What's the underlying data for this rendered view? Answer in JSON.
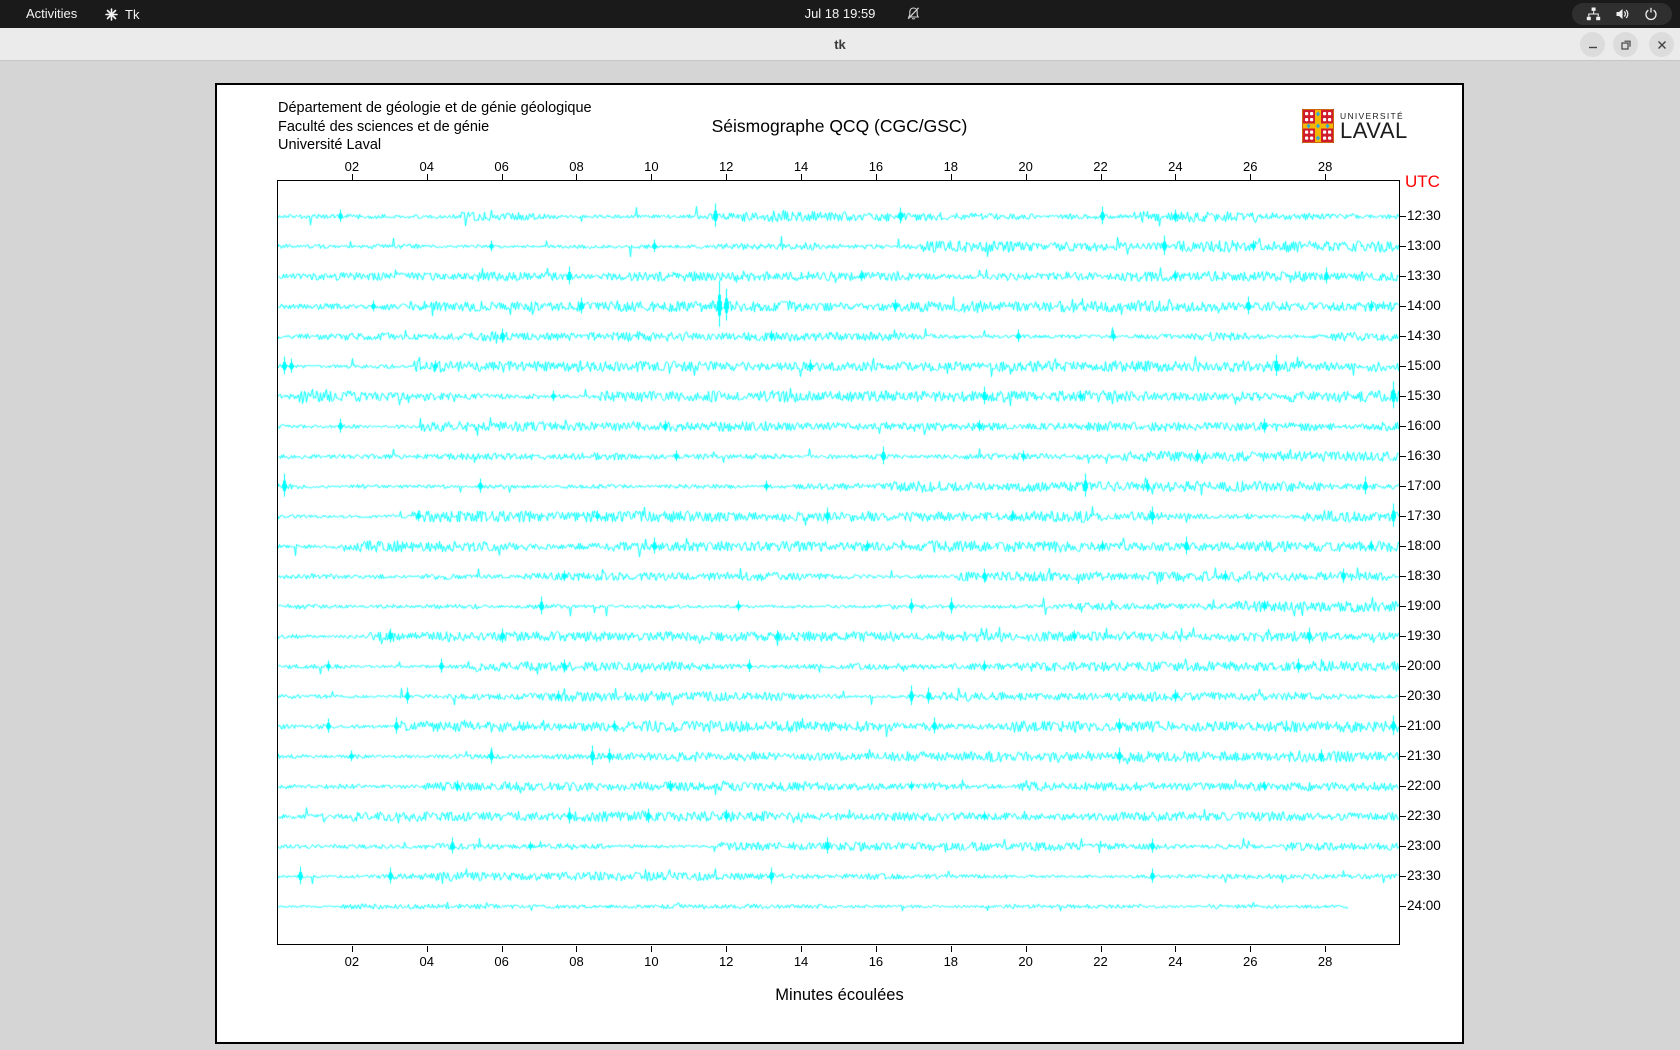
{
  "os_bar": {
    "activities_label": "Activities",
    "app_name": "Tk",
    "clock": "Jul 18 19:59",
    "icons": [
      "tk-logo",
      "notifications-off",
      "network",
      "volume",
      "power"
    ]
  },
  "window": {
    "title": "tk",
    "controls": {
      "minimize": "minimize",
      "maximize": "maximize",
      "close": "close"
    }
  },
  "seismograph": {
    "institution_lines": [
      "Département de géologie et de génie géologique",
      "Faculté des sciences et de génie",
      "Université Laval"
    ],
    "title": "Séismographe QCQ (CGC/GSC)",
    "logo": {
      "line1": "UNIVERSITÉ",
      "line2": "LAVAL",
      "crest_colors": {
        "red": "#d11c2e",
        "gold": "#f3b700",
        "blue": "#2aa9e0",
        "white": "#ffffff"
      }
    },
    "utc_label": "UTC",
    "xaxis_title": "Minutes écoulées",
    "x_range_minutes": [
      0,
      30
    ],
    "x_ticks": [
      {
        "label": "02",
        "minute": 2
      },
      {
        "label": "04",
        "minute": 4
      },
      {
        "label": "06",
        "minute": 6
      },
      {
        "label": "08",
        "minute": 8
      },
      {
        "label": "10",
        "minute": 10
      },
      {
        "label": "12",
        "minute": 12
      },
      {
        "label": "14",
        "minute": 14
      },
      {
        "label": "16",
        "minute": 16
      },
      {
        "label": "18",
        "minute": 18
      },
      {
        "label": "20",
        "minute": 20
      },
      {
        "label": "22",
        "minute": 22
      },
      {
        "label": "24",
        "minute": 24
      },
      {
        "label": "26",
        "minute": 26
      },
      {
        "label": "28",
        "minute": 28
      }
    ],
    "trace_color": "#00ffff",
    "utc_color": "#fe0000",
    "rows": [
      {
        "time": "12:30",
        "amp": 2.5,
        "end": 1.0,
        "spikes": [
          [
            0.055,
            7
          ],
          [
            0.39,
            13
          ],
          [
            0.555,
            9
          ],
          [
            0.735,
            10
          ],
          [
            0.8,
            7
          ]
        ]
      },
      {
        "time": "13:00",
        "amp": 2.5,
        "end": 1.0,
        "spikes": [
          [
            0.19,
            6
          ],
          [
            0.335,
            7
          ],
          [
            0.79,
            11
          ],
          [
            0.87,
            6
          ]
        ]
      },
      {
        "time": "13:30",
        "amp": 2.2,
        "end": 1.0,
        "spikes": [
          [
            0.26,
            10
          ],
          [
            0.52,
            6
          ],
          [
            0.8,
            6
          ],
          [
            0.935,
            9
          ]
        ]
      },
      {
        "time": "14:00",
        "amp": 2.5,
        "end": 1.0,
        "spikes": [
          [
            0.085,
            6
          ],
          [
            0.27,
            9
          ],
          [
            0.393,
            26
          ],
          [
            0.4,
            18
          ],
          [
            0.55,
            7
          ],
          [
            0.865,
            10
          ],
          [
            0.975,
            6
          ]
        ]
      },
      {
        "time": "14:30",
        "amp": 2.2,
        "end": 1.0,
        "spikes": [
          [
            0.2,
            8
          ],
          [
            0.44,
            6
          ],
          [
            0.66,
            7
          ],
          [
            0.745,
            6
          ]
        ]
      },
      {
        "time": "15:00",
        "amp": 2.5,
        "end": 1.0,
        "spikes": [
          [
            0.005,
            10
          ],
          [
            0.012,
            8
          ],
          [
            0.14,
            6
          ],
          [
            0.475,
            7
          ],
          [
            0.89,
            12
          ]
        ]
      },
      {
        "time": "15:30",
        "amp": 2.5,
        "end": 1.0,
        "spikes": [
          [
            0.245,
            6
          ],
          [
            0.63,
            10
          ],
          [
            0.715,
            6
          ],
          [
            0.995,
            15
          ]
        ]
      },
      {
        "time": "16:00",
        "amp": 2.2,
        "end": 1.0,
        "spikes": [
          [
            0.055,
            8
          ],
          [
            0.345,
            6
          ],
          [
            0.625,
            6
          ],
          [
            0.88,
            8
          ]
        ]
      },
      {
        "time": "16:30",
        "amp": 2.2,
        "end": 1.0,
        "spikes": [
          [
            0.355,
            6
          ],
          [
            0.54,
            10
          ],
          [
            0.665,
            6
          ],
          [
            0.82,
            7
          ]
        ]
      },
      {
        "time": "17:00",
        "amp": 2.5,
        "end": 1.0,
        "spikes": [
          [
            0.005,
            13
          ],
          [
            0.18,
            8
          ],
          [
            0.435,
            6
          ],
          [
            0.72,
            13
          ],
          [
            0.775,
            7
          ],
          [
            0.97,
            10
          ]
        ]
      },
      {
        "time": "17:30",
        "amp": 2.5,
        "end": 1.0,
        "spikes": [
          [
            0.125,
            6
          ],
          [
            0.285,
            6
          ],
          [
            0.49,
            9
          ],
          [
            0.655,
            6
          ],
          [
            0.78,
            10
          ],
          [
            0.995,
            13
          ]
        ]
      },
      {
        "time": "18:00",
        "amp": 2.5,
        "end": 1.0,
        "spikes": [
          [
            0.335,
            9
          ],
          [
            0.525,
            6
          ],
          [
            0.735,
            6
          ],
          [
            0.81,
            10
          ],
          [
            0.975,
            6
          ]
        ]
      },
      {
        "time": "18:30",
        "amp": 2.2,
        "end": 1.0,
        "spikes": [
          [
            0.255,
            6
          ],
          [
            0.63,
            8
          ],
          [
            0.845,
            6
          ],
          [
            0.95,
            8
          ]
        ]
      },
      {
        "time": "19:00",
        "amp": 2.5,
        "end": 1.0,
        "spikes": [
          [
            0.235,
            10
          ],
          [
            0.41,
            6
          ],
          [
            0.565,
            8
          ],
          [
            0.6,
            9
          ],
          [
            0.88,
            6
          ]
        ]
      },
      {
        "time": "19:30",
        "amp": 2.2,
        "end": 1.0,
        "spikes": [
          [
            0.1,
            8
          ],
          [
            0.2,
            8
          ],
          [
            0.445,
            6
          ],
          [
            0.71,
            6
          ],
          [
            0.92,
            9
          ]
        ]
      },
      {
        "time": "20:00",
        "amp": 2.2,
        "end": 1.0,
        "spikes": [
          [
            0.045,
            6
          ],
          [
            0.145,
            8
          ],
          [
            0.255,
            7
          ],
          [
            0.42,
            7
          ],
          [
            0.63,
            6
          ],
          [
            0.91,
            8
          ]
        ]
      },
      {
        "time": "20:30",
        "amp": 2.2,
        "end": 1.0,
        "spikes": [
          [
            0.115,
            9
          ],
          [
            0.25,
            6
          ],
          [
            0.565,
            11
          ],
          [
            0.58,
            9
          ],
          [
            0.8,
            7
          ]
        ]
      },
      {
        "time": "21:00",
        "amp": 2.5,
        "end": 1.0,
        "spikes": [
          [
            0.045,
            8
          ],
          [
            0.105,
            9
          ],
          [
            0.3,
            6
          ],
          [
            0.585,
            9
          ],
          [
            0.75,
            8
          ],
          [
            0.995,
            11
          ]
        ]
      },
      {
        "time": "21:30",
        "amp": 2.5,
        "end": 1.0,
        "spikes": [
          [
            0.065,
            6
          ],
          [
            0.19,
            9
          ],
          [
            0.28,
            11
          ],
          [
            0.295,
            8
          ],
          [
            0.75,
            9
          ],
          [
            0.93,
            7
          ]
        ]
      },
      {
        "time": "22:00",
        "amp": 2.0,
        "end": 1.0,
        "spikes": [
          [
            0.16,
            6
          ],
          [
            0.35,
            6
          ],
          [
            0.565,
            5
          ],
          [
            0.88,
            5
          ]
        ]
      },
      {
        "time": "22:30",
        "amp": 2.2,
        "end": 1.0,
        "spikes": [
          [
            0.26,
            9
          ],
          [
            0.33,
            8
          ],
          [
            0.4,
            7
          ],
          [
            0.63,
            5
          ]
        ]
      },
      {
        "time": "23:00",
        "amp": 2.0,
        "end": 1.0,
        "spikes": [
          [
            0.155,
            9
          ],
          [
            0.225,
            5
          ],
          [
            0.49,
            9
          ],
          [
            0.78,
            8
          ]
        ]
      },
      {
        "time": "23:30",
        "amp": 2.0,
        "end": 1.0,
        "spikes": [
          [
            0.02,
            10
          ],
          [
            0.1,
            9
          ],
          [
            0.44,
            9
          ],
          [
            0.78,
            8
          ]
        ]
      },
      {
        "time": "24:00",
        "amp": 1.1,
        "end": 0.955,
        "spikes": []
      }
    ]
  }
}
